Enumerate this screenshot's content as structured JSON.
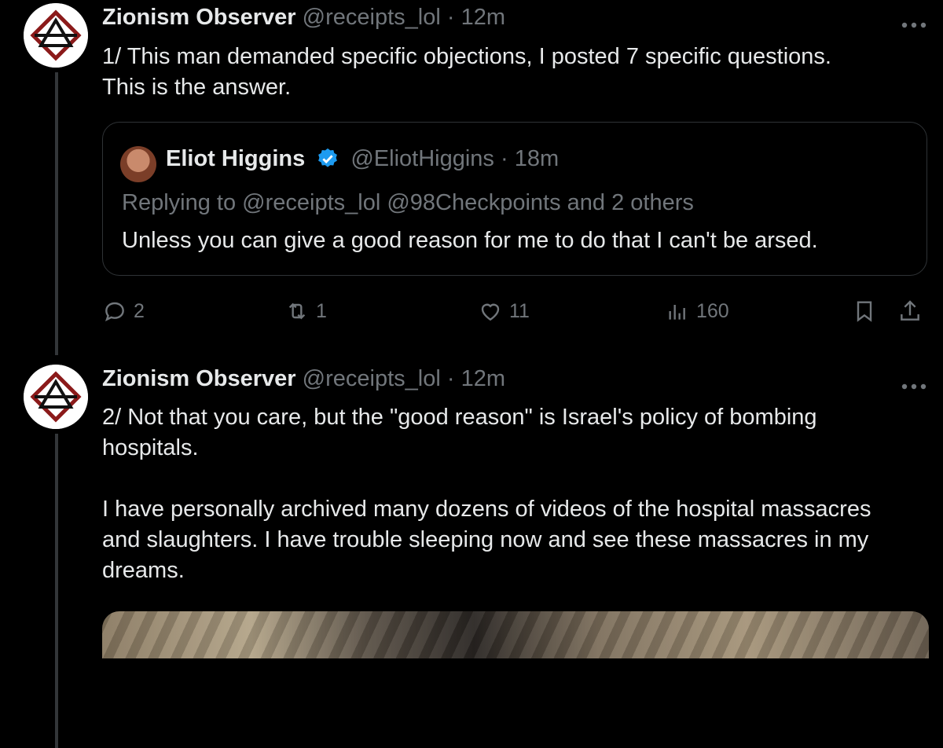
{
  "tweets": [
    {
      "author_name": "Zionism Observer",
      "handle": "@receipts_lol",
      "separator": "·",
      "time": "12m",
      "text": "1/ This man demanded specific objections, I posted 7 specific questions.\nThis is the answer.",
      "quote": {
        "author_name": "Eliot Higgins",
        "handle": "@EliotHiggins",
        "separator": "·",
        "time": "18m",
        "replying_to": "Replying to @receipts_lol @98Checkpoints and 2 others",
        "text": "Unless you can give a good reason for me to do that I can't be arsed."
      },
      "stats": {
        "replies": "2",
        "retweets": "1",
        "likes": "11",
        "views": "160"
      }
    },
    {
      "author_name": "Zionism Observer",
      "handle": "@receipts_lol",
      "separator": "·",
      "time": "12m",
      "text": "2/ Not that you care, but the \"good reason\" is Israel's policy of bombing\nhospitals.\n\nI have personally archived many dozens of videos of the hospital massacres\nand slaughters. I have trouble sleeping now and see these massacres in my\ndreams."
    }
  ],
  "colors": {
    "background": "#000000",
    "text": "#e7e9ea",
    "muted": "#71767b",
    "accent": "#1d9bf0",
    "logo_red": "#8b1a1a"
  },
  "icons": [
    "reply-icon",
    "retweet-icon",
    "like-icon",
    "views-icon",
    "bookmark-icon",
    "share-icon",
    "more-icon",
    "verified-badge-icon"
  ]
}
